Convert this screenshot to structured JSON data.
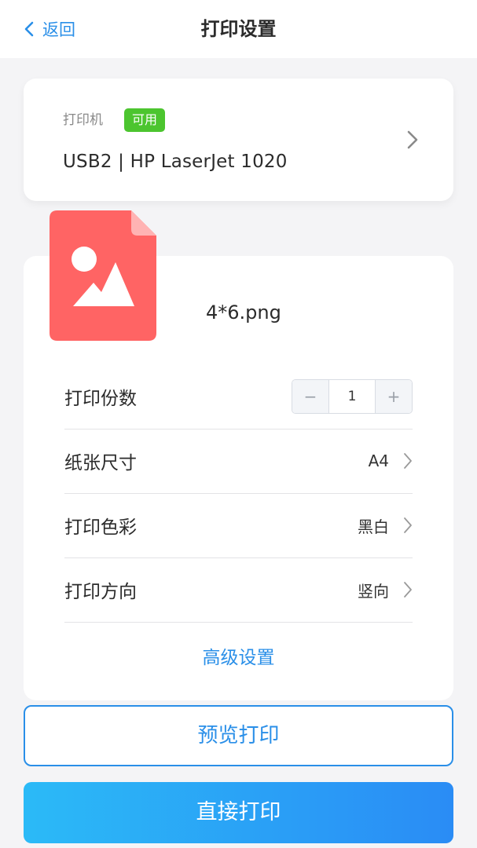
{
  "header": {
    "back_label": "返回",
    "title": "打印设置"
  },
  "printer": {
    "label": "打印机",
    "status": "可用",
    "name": "USB2 | HP LaserJet 1020"
  },
  "file": {
    "name": "4*6.png",
    "icon": "image-file-icon"
  },
  "settings": {
    "copies": {
      "label": "打印份数",
      "value": "1",
      "minus": "−",
      "plus": "+"
    },
    "paper_size": {
      "label": "纸张尺寸",
      "value": "A4"
    },
    "color": {
      "label": "打印色彩",
      "value": "黑白"
    },
    "orientation": {
      "label": "打印方向",
      "value": "竖向"
    }
  },
  "advanced_label": "高级设置",
  "actions": {
    "preview": "预览打印",
    "print": "直接打印"
  },
  "colors": {
    "accent": "#2a8fe8",
    "badge": "#4cc52f",
    "file_icon": "#ff6464"
  }
}
